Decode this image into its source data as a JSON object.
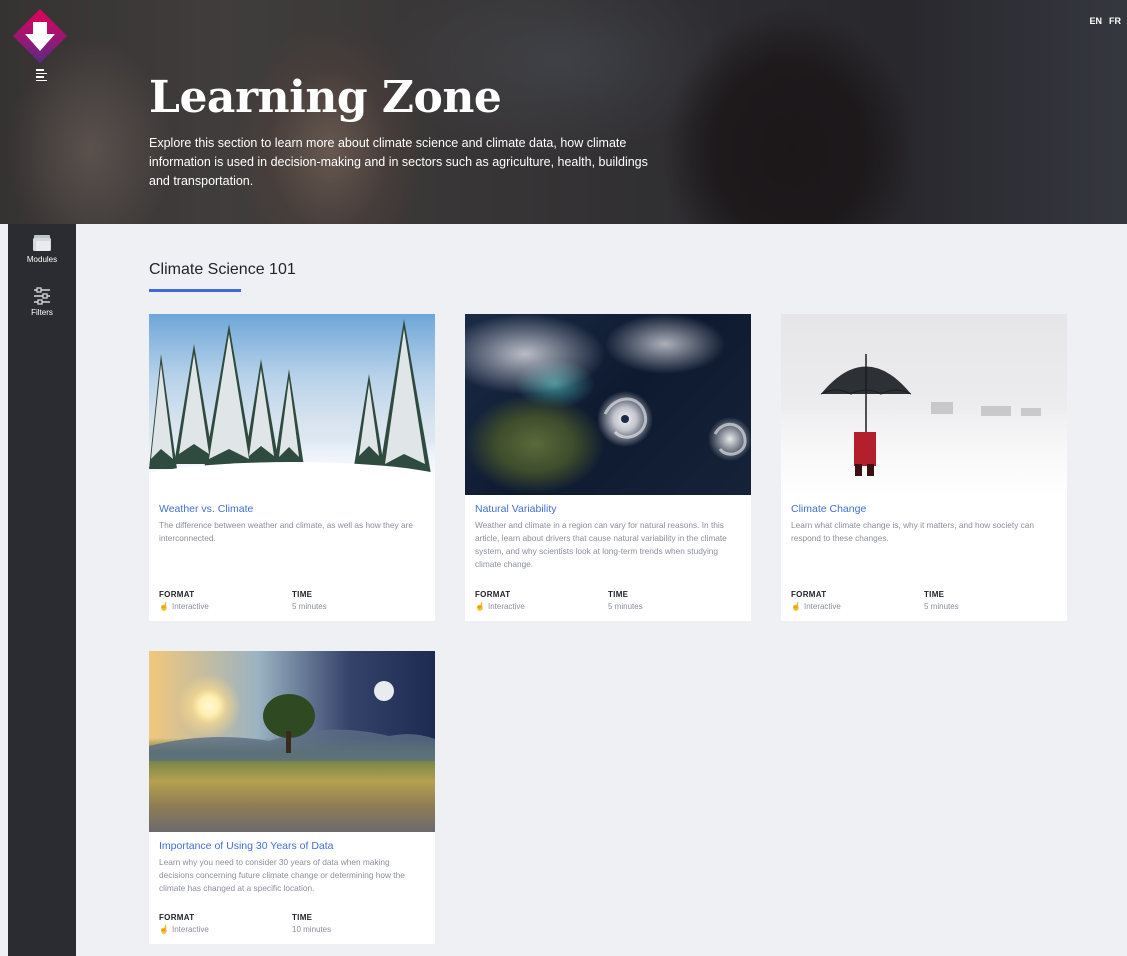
{
  "hero": {
    "title": "Learning Zone",
    "description": "Explore this section to learn more about climate science and climate data, how climate information is used in decision-making and in sectors such as agriculture, health, buildings and transportation."
  },
  "language": {
    "en": "EN",
    "fr": "FR"
  },
  "sidebar": {
    "items": [
      {
        "label": "Modules",
        "icon": "modules-icon"
      },
      {
        "label": "Filters",
        "icon": "filters-icon"
      }
    ]
  },
  "section": {
    "title": "Climate Science 101",
    "accent_color": "#3d6bd9"
  },
  "labels": {
    "format": "FORMAT",
    "time": "TIME"
  },
  "cards": [
    {
      "title": "Weather vs. Climate",
      "description": "The difference between weather and climate, as well as how they are interconnected.",
      "format": "Interactive",
      "time": "5 minutes"
    },
    {
      "title": "Natural Variability",
      "description": "Weather and climate in a region can vary for natural reasons. In this article, learn about drivers that cause natural variability in the climate system, and why scientists look at long-term trends when studying climate change.",
      "format": "Interactive",
      "time": "5 minutes"
    },
    {
      "title": "Climate Change",
      "description": "Learn what climate change is, why it matters, and how society can respond to these changes.",
      "format": "Interactive",
      "time": "5 minutes"
    },
    {
      "title": "Importance of Using 30 Years of Data",
      "description": "Learn why you need to consider 30 years of data when making decisions concerning future climate change or determining how the climate has changed at a specific location.",
      "format": "Interactive",
      "time": "10 minutes"
    }
  ],
  "colors": {
    "link": "#3f6fd8",
    "sidebar": "#2a2c31",
    "page_background": "#eef0f4",
    "logo_top": "#e5005a",
    "logo_bottom": "#5b2a86"
  }
}
